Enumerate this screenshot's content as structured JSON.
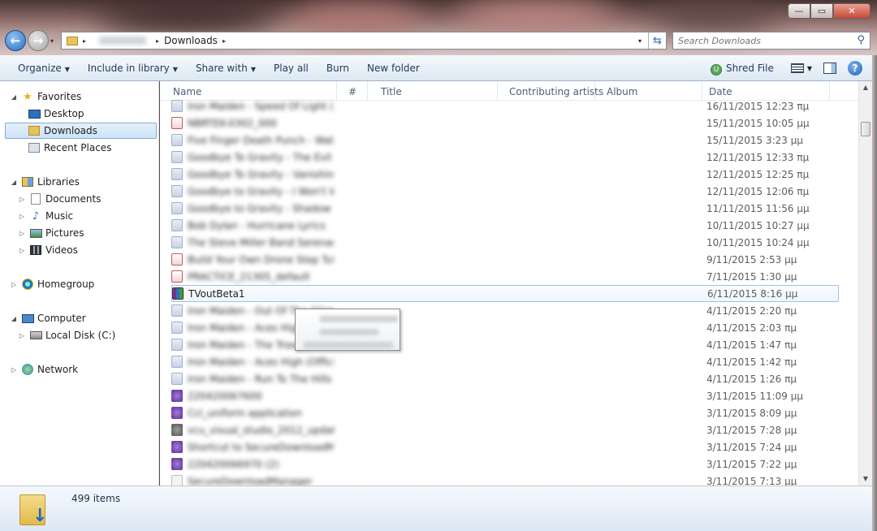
{
  "window": {
    "minimize": "—",
    "maximize": "▭",
    "close": "✕"
  },
  "address": {
    "current": "Downloads",
    "separator": "▸"
  },
  "search": {
    "placeholder": "Search Downloads"
  },
  "toolbar": {
    "items": [
      "Organize",
      "Include in library",
      "Share with",
      "Play all",
      "Burn",
      "New folder"
    ],
    "shred_file": "Shred File"
  },
  "nav": {
    "favorites": "Favorites",
    "desktop": "Desktop",
    "downloads": "Downloads",
    "recent_places": "Recent Places",
    "libraries": "Libraries",
    "documents": "Documents",
    "music": "Music",
    "pictures": "Pictures",
    "videos": "Videos",
    "homegroup": "Homegroup",
    "computer": "Computer",
    "local_disk": "Local Disk (C:)",
    "network": "Network"
  },
  "columns": [
    "Name",
    "#",
    "Title",
    "Contributing artists",
    "Album",
    "Date"
  ],
  "files": [
    {
      "name": "Iron Maiden - Speed Of Light (Lyrics)",
      "date": "16/11/2015 12:23 πμ",
      "type": "audio"
    },
    {
      "name": "NBRTEK-0302_000",
      "date": "15/11/2015 10:05 μμ",
      "type": "pdf"
    },
    {
      "name": "Five Finger Death Punch - Watch You Bleed",
      "date": "15/11/2015 3:23 μμ",
      "type": "audio"
    },
    {
      "name": "Goodbye To Gravity - The Evil That Men Do",
      "date": "12/11/2015 12:33 πμ",
      "type": "audio"
    },
    {
      "name": "Goodbye To Gravity - Vanishing Point",
      "date": "12/11/2015 12:25 πμ",
      "type": "audio"
    },
    {
      "name": "Goodbye to Gravity - I Won't Wait",
      "date": "12/11/2015 12:06 πμ",
      "type": "audio"
    },
    {
      "name": "Goodbye to Gravity - Shadow Puppets",
      "date": "11/11/2015 11:56 μμ",
      "type": "audio"
    },
    {
      "name": "Bob Dylan - Hurricane Lyrics",
      "date": "10/11/2015 10:27 μμ",
      "type": "audio"
    },
    {
      "name": "The Steve Miller Band Serenade",
      "date": "10/11/2015 10:24 μμ",
      "type": "audio"
    },
    {
      "name": "Build Your Own Drone Step Tutorial",
      "date": "9/11/2015 2:53 μμ",
      "type": "pdf"
    },
    {
      "name": "PRACTICE_21305_default",
      "date": "7/11/2015 1:30 μμ",
      "type": "pdf"
    },
    {
      "name": "TVoutBeta1",
      "date": "6/11/2015 8:16 μμ",
      "type": "rar",
      "selected": true
    },
    {
      "name": "Iron Maiden - Out Of The Silent Planet",
      "date": "4/11/2015 2:20 πμ",
      "type": "audio"
    },
    {
      "name": "Iron Maiden - Aces High",
      "date": "4/11/2015 2:03 πμ",
      "type": "audio"
    },
    {
      "name": "Iron Maiden - The Trooper",
      "date": "4/11/2015 1:47 πμ",
      "type": "audio"
    },
    {
      "name": "Iron Maiden - Aces High (Official Video)",
      "date": "4/11/2015 1:42 πμ",
      "type": "audio"
    },
    {
      "name": "Iron Maiden - Run To The Hills Lyrics",
      "date": "4/11/2015 1:26 πμ",
      "type": "audio"
    },
    {
      "name": "220420067600",
      "date": "3/11/2015 11:09 μμ",
      "type": "app"
    },
    {
      "name": "Ccl_uniform application",
      "date": "3/11/2015 8:09 μμ",
      "type": "app"
    },
    {
      "name": "vcu_visual_studio_2012_update_4",
      "date": "3/11/2015 7:28 μμ",
      "type": "gray"
    },
    {
      "name": "Shortcut to SecureDownloadManager",
      "date": "3/11/2015 7:24 μμ",
      "type": "app"
    },
    {
      "name": "220420066970 (2)",
      "date": "3/11/2015 7:22 μμ",
      "type": "app"
    },
    {
      "name": "SecureDownloadManager",
      "date": "3/11/2015 7:13 μμ",
      "type": "doc"
    }
  ],
  "status": {
    "count": "499 items"
  }
}
